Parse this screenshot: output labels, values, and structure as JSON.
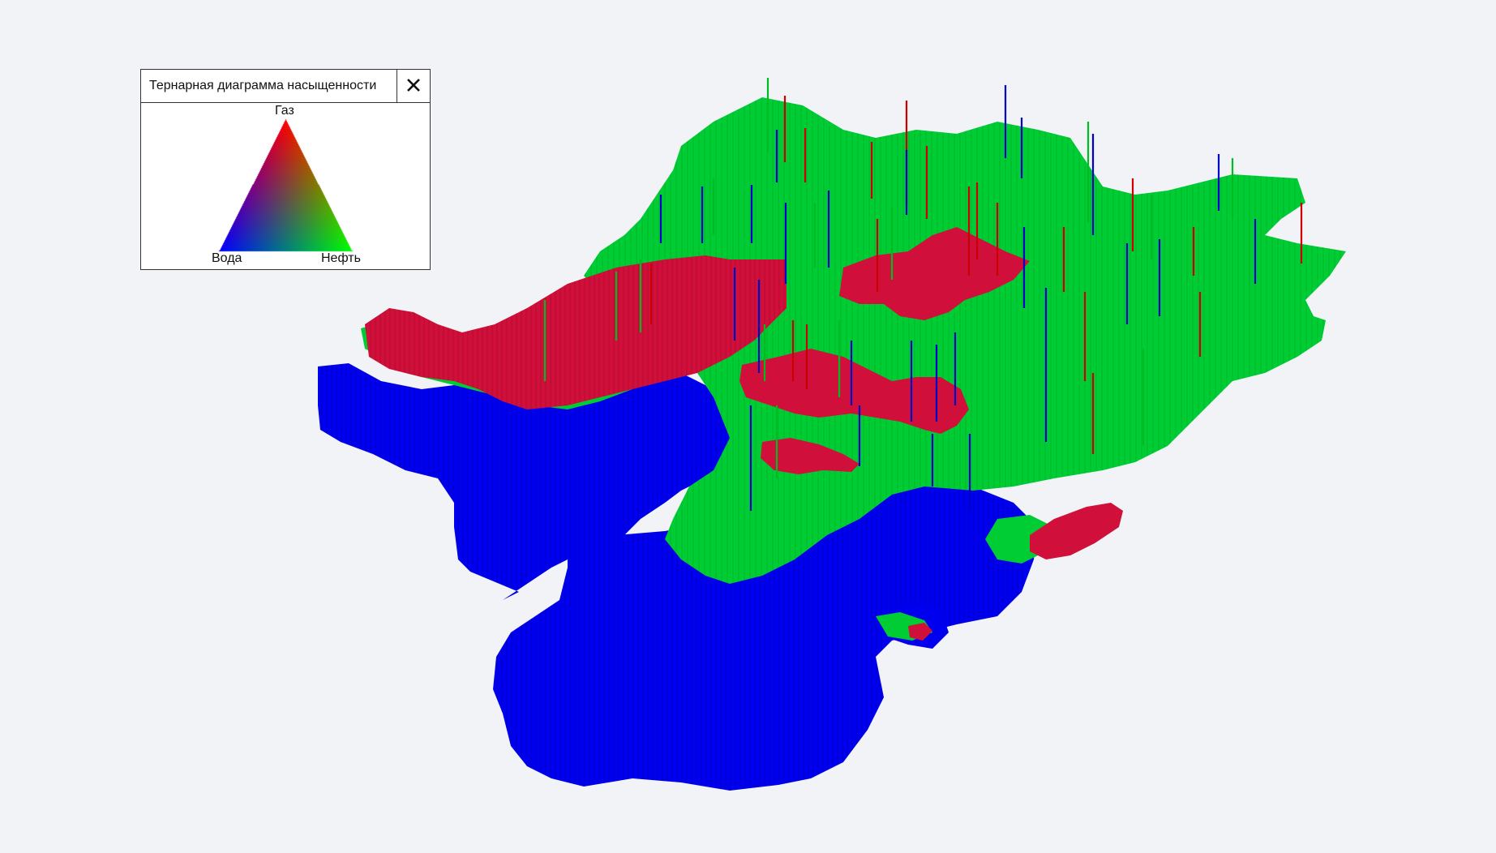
{
  "legend": {
    "title": "Тернарная диаграмма насыщенности",
    "close_icon": "close-icon",
    "vertices": {
      "top": "Газ",
      "left": "Вода",
      "right": "Нефть"
    },
    "colors": {
      "gas": "#ff0000",
      "water": "#0000ff",
      "oil": "#00ff00"
    }
  },
  "model_colors": {
    "water_zone": "#0000ee",
    "oil_zone": "#00cc33",
    "gas_zone": "#d0103a",
    "background": "#f1f3f7"
  }
}
